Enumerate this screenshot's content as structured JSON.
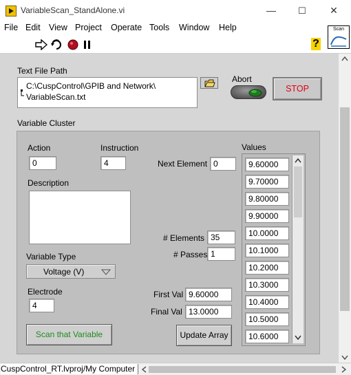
{
  "window": {
    "title": "VariableScan_StandAlone.vi",
    "min_glyph": "—",
    "max_glyph": "☐",
    "close_glyph": "✕"
  },
  "menu": [
    "File",
    "Edit",
    "View",
    "Project",
    "Operate",
    "Tools",
    "Window",
    "Help"
  ],
  "toolbar": {
    "help_glyph": "?",
    "vi_icon_label": "Scan"
  },
  "text_file_path": {
    "label": "Text File Path",
    "line1": "C:\\CuspControl\\GPIB and Network\\",
    "line2": "VariableScan.txt"
  },
  "abort": {
    "label": "Abort"
  },
  "stop": {
    "label": "STOP",
    "color": "#e0001a"
  },
  "cluster": {
    "label": "Variable Cluster",
    "action": {
      "label": "Action",
      "value": "0"
    },
    "instruction": {
      "label": "Instruction",
      "value": "4"
    },
    "next_element": {
      "label": "Next Element",
      "value": "0"
    },
    "description": {
      "label": "Description",
      "value": ""
    },
    "elements": {
      "label": "# Elements",
      "value": "35"
    },
    "passes": {
      "label": "# Passes",
      "value": "1"
    },
    "variable_type": {
      "label": "Variable Type",
      "value": "Voltage (V)"
    },
    "electrode": {
      "label": "Electrode",
      "value": "4"
    },
    "first_val": {
      "label": "First Val",
      "value": "9.60000"
    },
    "final_val": {
      "label": "Final Val",
      "value": "13.0000"
    },
    "scan_button": {
      "label": "Scan that Variable",
      "color": "#1e8a1e"
    },
    "update_button": {
      "label": "Update Array"
    },
    "values": {
      "label": "Values",
      "items": [
        "9.60000",
        "9.70000",
        "9.80000",
        "9.90000",
        "10.0000",
        "10.1000",
        "10.2000",
        "10.3000",
        "10.4000",
        "10.5000",
        "10.6000"
      ]
    }
  },
  "status": {
    "context": "CuspControl_RT.lvproj/My Computer"
  }
}
